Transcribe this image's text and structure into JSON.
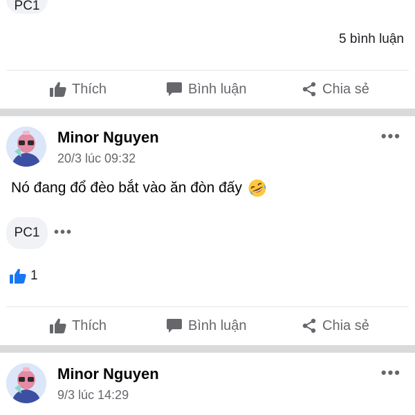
{
  "post1": {
    "chip_label": "PC1",
    "comment_count": "5 bình luận",
    "actions": {
      "like": "Thích",
      "comment": "Bình luận",
      "share": "Chia sẻ"
    }
  },
  "post2": {
    "author": "Minor Nguyen",
    "timestamp": "20/3 lúc 09:32",
    "more_label": "•••",
    "text": "Nó đang đổ đèo bắt vào ăn đòn đấy",
    "emoji": "rolling-on-floor-laughing-emoji",
    "chip_label": "PC1",
    "chip_more": "•••",
    "like_count": "1",
    "actions": {
      "like": "Thích",
      "comment": "Bình luận",
      "share": "Chia sẻ"
    }
  },
  "post3": {
    "author": "Minor Nguyen",
    "timestamp": "9/3 lúc 14:29",
    "more_label": "•••"
  },
  "colors": {
    "secondary_text": "#65676b",
    "divider": "#d9dadc",
    "like_blue": "#1877f2",
    "chip_bg": "#f0f2f5"
  }
}
